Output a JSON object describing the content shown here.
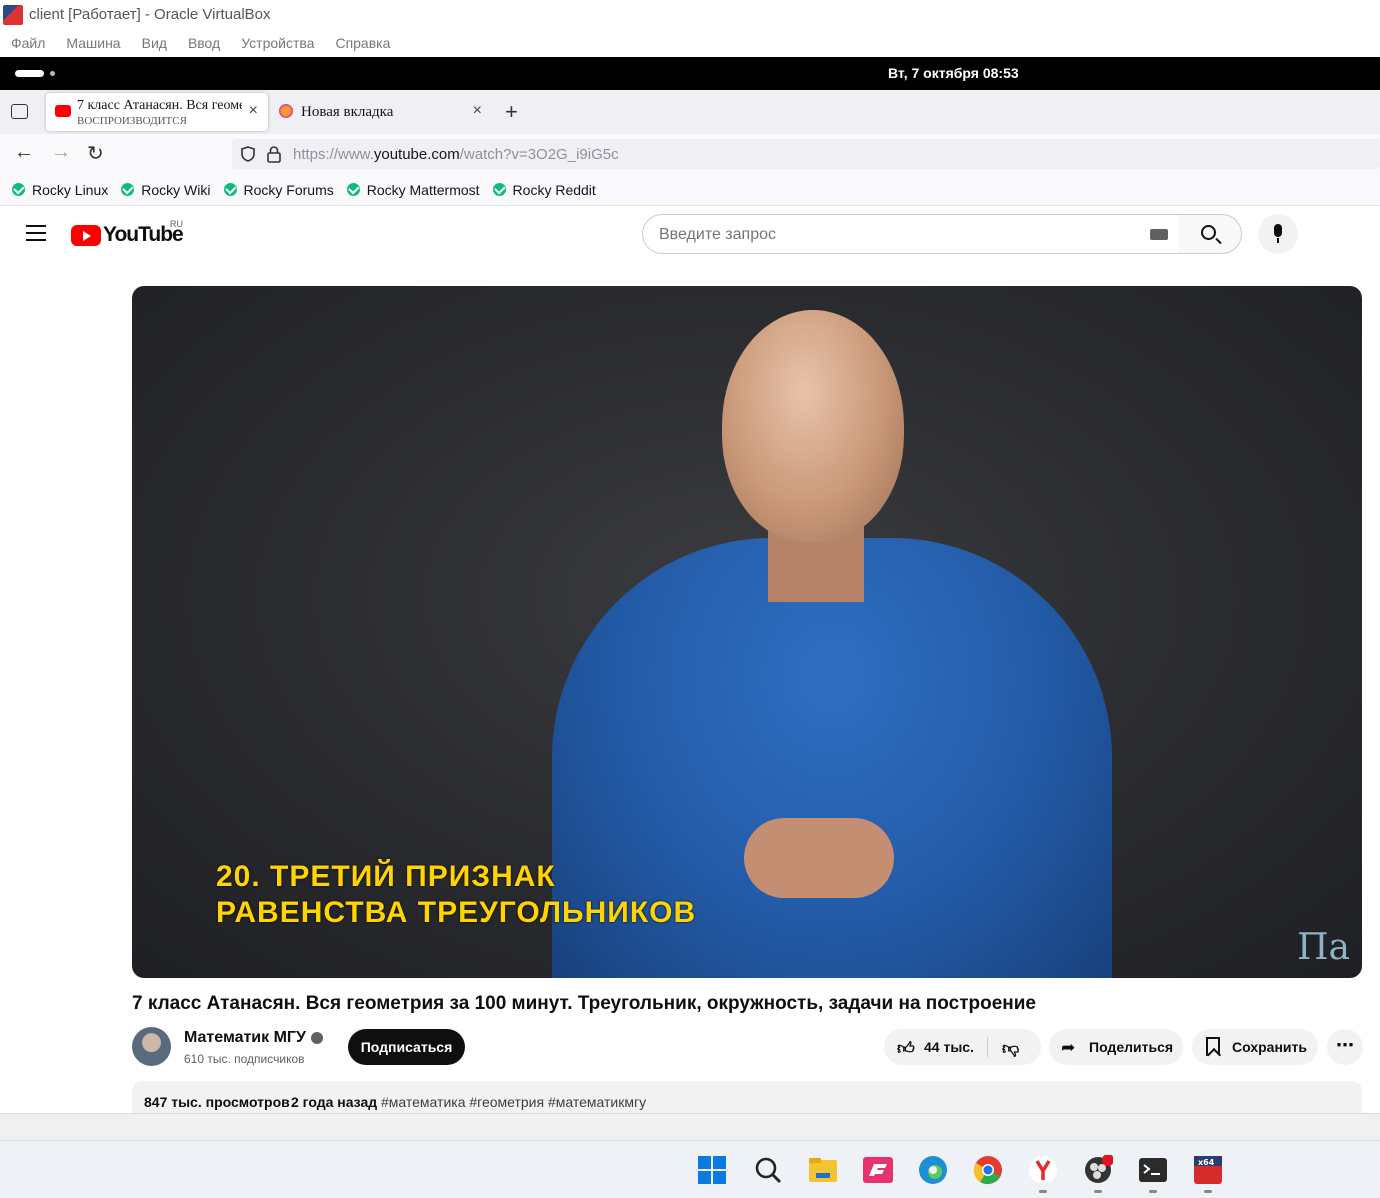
{
  "vbox": {
    "title": "client [Работает] - Oracle VirtualBox",
    "menu": [
      "Файл",
      "Машина",
      "Вид",
      "Ввод",
      "Устройства",
      "Справка"
    ]
  },
  "gnome": {
    "clock": "Вт, 7 октября  08:53"
  },
  "browser": {
    "tabs": [
      {
        "title": "7 класс Атанасян. Вся геометрия за 100 минут",
        "subtitle": "воспроизводится",
        "active": true,
        "close": "×"
      },
      {
        "title": "Новая вкладка",
        "active": false,
        "close": "×"
      }
    ],
    "new_tab": "+",
    "url_prefix": "https://www.",
    "url_domain": "youtube.com",
    "url_path": "/watch?v=3O2G_i9iG5c",
    "bookmarks": [
      "Rocky Linux",
      "Rocky Wiki",
      "Rocky Forums",
      "Rocky Mattermost",
      "Rocky Reddit"
    ]
  },
  "youtube": {
    "logo_text": "YouTube",
    "region": "RU",
    "search_placeholder": "Введите запрос",
    "video": {
      "caption_line1": "20. ТРЕТИЙ ПРИЗНАК",
      "caption_line2": "РАВЕНСТВА ТРЕУГОЛЬНИКОВ",
      "watermark": "Πa"
    },
    "title": "7 класс Атанасян. Вся геометрия за 100 минут. Треугольник, окружность, задачи на построение",
    "channel": "Математик МГУ",
    "subscribers": "610 тыс. подписчиков",
    "subscribe_label": "Подписаться",
    "likes": "44 тыс.",
    "share_label": "Поделиться",
    "save_label": "Сохранить",
    "more_label": "⋯",
    "views": "847 тыс. просмотров",
    "published": "2 года назад",
    "tags": "#математика #геометрия #математикмгу"
  },
  "colors": {
    "yt_red": "#ff0000",
    "rocky_green": "#10b981",
    "caption_yellow": "#ffd400"
  }
}
